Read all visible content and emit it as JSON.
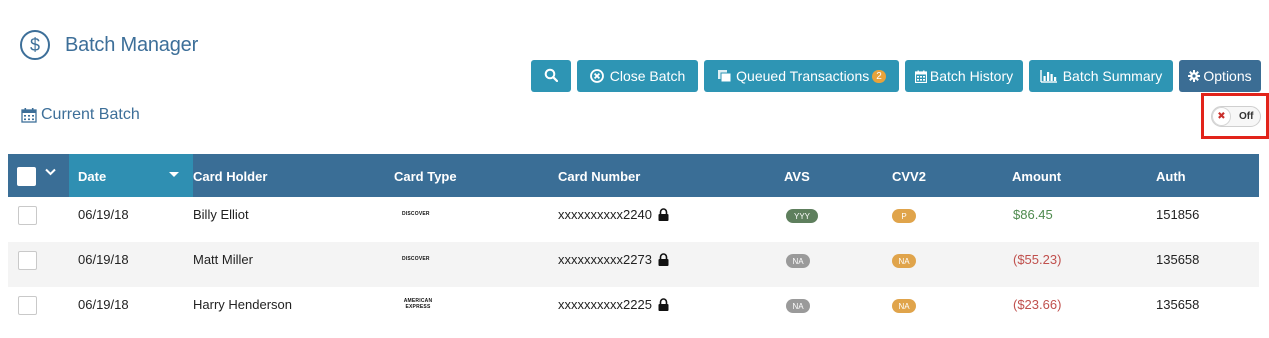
{
  "header": {
    "title": "Batch Manager",
    "icon": "dollar-circle-icon"
  },
  "section": {
    "label": "Current Batch",
    "icon": "calendar-icon"
  },
  "toolbar": {
    "search_icon": "search-icon",
    "close_batch": "Close Batch",
    "queued": "Queued Transactions",
    "queued_count": "2",
    "history": "Batch History",
    "summary": "Batch Summary",
    "options": "Options"
  },
  "toggle": {
    "state_label": "Off"
  },
  "table": {
    "columns": [
      "Date",
      "Card Holder",
      "Card Type",
      "Card Number",
      "AVS",
      "CVV2",
      "Amount",
      "Auth"
    ],
    "rows": [
      {
        "date": "06/19/18",
        "holder": "Billy Elliot",
        "card_type": "DISCOVER",
        "card_number": "xxxxxxxxxx2240",
        "avs": "YYY",
        "cvv2": "P",
        "amount": "$86.45",
        "auth": "151856"
      },
      {
        "date": "06/19/18",
        "holder": "Matt Miller",
        "card_type": "DISCOVER",
        "card_number": "xxxxxxxxxx2273",
        "avs": "NA",
        "cvv2": "NA",
        "amount": "($55.23)",
        "auth": "135658"
      },
      {
        "date": "06/19/18",
        "holder": "Harry Henderson",
        "card_type": "AMERICAN EXPRESS",
        "card_number": "xxxxxxxxxx2225",
        "avs": "NA",
        "cvv2": "NA",
        "amount": "($23.66)",
        "auth": "135658"
      }
    ]
  },
  "colors": {
    "primary": "#2e95b4",
    "header_bg": "#3a6e96",
    "title": "#3d6f99",
    "highlight": "#e2231a",
    "positive": "#4e8a4e",
    "negative": "#c0504d"
  }
}
